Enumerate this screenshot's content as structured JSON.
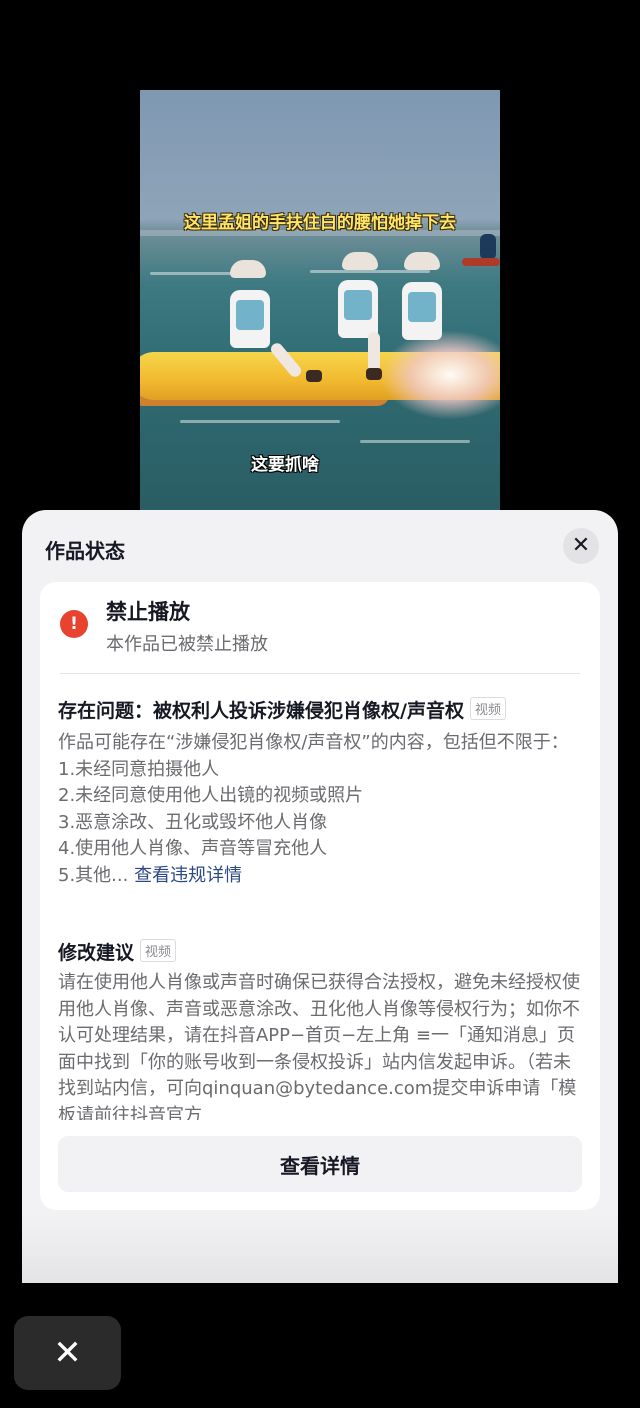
{
  "video": {
    "subtitle_top": "这里孟姐的手扶住白的腰怕她掉下去",
    "subtitle_bottom": "这要抓啥"
  },
  "sheet": {
    "title": "作品状态",
    "close_icon": "close-icon"
  },
  "status": {
    "icon": "alert-circle-icon",
    "color": "#e8432f",
    "title": "禁止播放",
    "subtitle": "本作品已被禁止播放"
  },
  "issue": {
    "title": "存在问题：被权利人投诉涉嫌侵犯肖像权/声音权",
    "tag": "视频",
    "intro": "作品可能存在“涉嫌侵犯肖像权/声音权”的内容，包括但不限于：",
    "items": [
      "1.未经同意拍摄他人",
      "2.未经同意使用他人出镜的视频或照片",
      "3.恶意涂改、丑化或毁坏他人肖像",
      "4.使用他人肖像、声音等冒充他人",
      "5.其他..."
    ],
    "link": "查看违规详情"
  },
  "suggestion": {
    "title": "修改建议",
    "tag": "视频",
    "body": "请在使用他人肖像或声音时确保已获得合法授权，避免未经授权使用他人肖像、声音或恶意涂改、丑化他人肖像等侵权行为；如你不认可处理结果，请在抖音APP−首页−左上角 ≡一「通知消息」页面中找到「你的账号收到一条侵权投诉」站内信发起申诉。（若未找到站内信，可向qinquan@bytedance.com提交申诉申请「模板请前往抖音官方"
  },
  "detail_button": "查看详情",
  "dismiss_icon": "close-icon"
}
